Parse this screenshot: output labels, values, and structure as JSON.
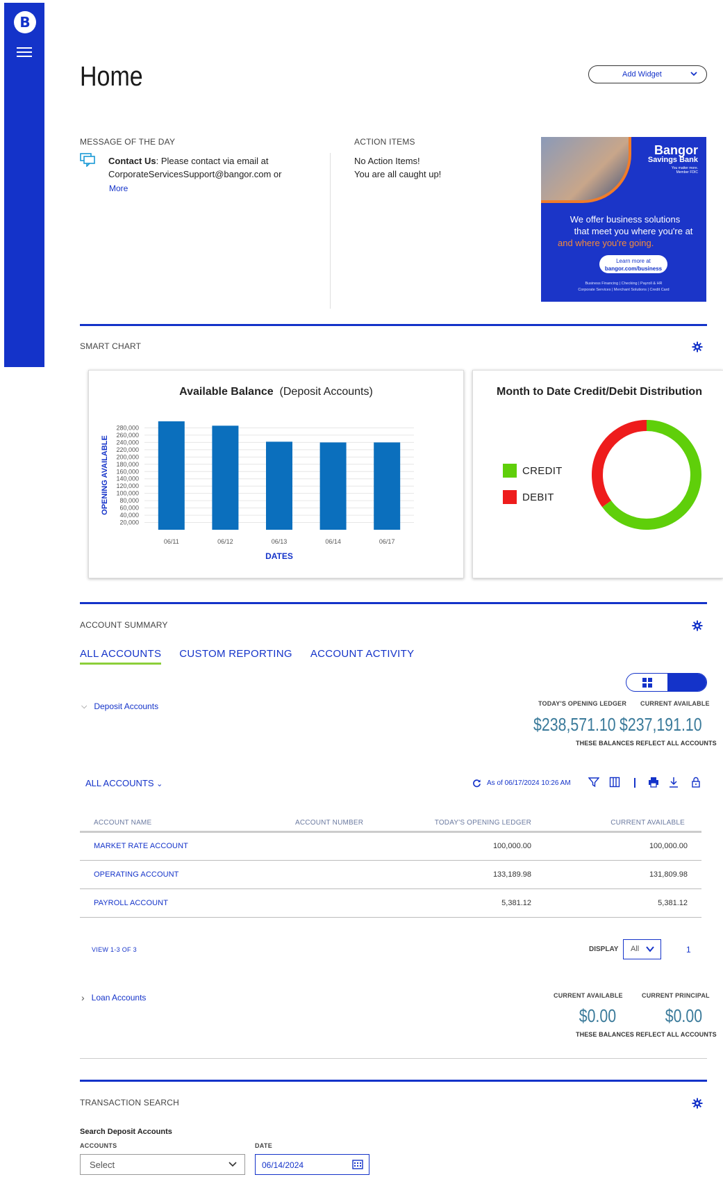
{
  "brand": {
    "logo_letter": "B",
    "accent": "#1433c9"
  },
  "page": {
    "title": "Home",
    "add_widget_label": "Add Widget"
  },
  "message_of_day": {
    "section_label": "MESSAGE OF THE DAY",
    "icon": "chat-icon",
    "bold_prefix": "Contact Us",
    "text": ": Please contact via email at CorporateServicesSupport@bangor.com or",
    "more_label": "More"
  },
  "action_items": {
    "section_label": "ACTION ITEMS",
    "line1": "No Action Items!",
    "line2": "You are all caught up!"
  },
  "promo": {
    "bank_name_1": "Bangor",
    "bank_name_2": "Savings Bank",
    "tagline": "You matter more.",
    "member": "Member FDIC",
    "headline_1": "We offer business solutions",
    "headline_2": "that meet you where you're at",
    "headline_3": "and where you're going.",
    "cta_1": "Learn more at",
    "cta_2": "bangor.com/business",
    "fine_1": "Business Financing | Checking | Payroll & HR",
    "fine_2": "Corporate Services | Merchant Solutions | Credit Card"
  },
  "smart_chart": {
    "section_label": "SMART CHART"
  },
  "chart_data": [
    {
      "type": "bar",
      "title_bold": "Available Balance",
      "title_rest": "(Deposit Accounts)",
      "xlabel": "DATES",
      "ylabel": "OPENING AVAILABLE",
      "categories": [
        "06/11",
        "06/12",
        "06/13",
        "06/14",
        "06/17"
      ],
      "values": [
        298000,
        286000,
        242000,
        240000,
        240000
      ],
      "yticks": [
        "280,000",
        "260,000",
        "240,000",
        "220,000",
        "200,000",
        "180,000",
        "160,000",
        "140,000",
        "120,000",
        "100,000",
        "80,000",
        "60,000",
        "40,000",
        "20,000"
      ],
      "ylim": [
        0,
        300000
      ],
      "bar_color": "#0b6fbd",
      "grid": true
    },
    {
      "type": "pie",
      "title": "Month to Date Credit/Debit Distribution",
      "labels": [
        "CREDIT",
        "DEBIT"
      ],
      "values": [
        65,
        35
      ],
      "colors": [
        "#5fcf0a",
        "#ee1c1c"
      ]
    }
  ],
  "account_summary": {
    "section_label": "ACCOUNT SUMMARY",
    "tabs": [
      {
        "label": "ALL ACCOUNTS",
        "active": true
      },
      {
        "label": "CUSTOM REPORTING",
        "active": false
      },
      {
        "label": "ACCOUNT ACTIVITY",
        "active": false
      }
    ],
    "deposit": {
      "group_label": "Deposit Accounts",
      "opening_label": "TODAY'S OPENING LEDGER",
      "available_label": "CURRENT AVAILABLE",
      "opening_value": "$238,571.10",
      "available_value": "$237,191.10",
      "note": "THESE BALANCES REFLECT ALL ACCOUNTS"
    },
    "filter_label": "ALL ACCOUNTS",
    "as_of": "As of 06/17/2024 10:26 AM",
    "table": {
      "headers": [
        "ACCOUNT NAME",
        "ACCOUNT NUMBER",
        "TODAY'S OPENING LEDGER",
        "CURRENT AVAILABLE"
      ],
      "rows": [
        {
          "name": "MARKET RATE ACCOUNT",
          "number": "",
          "opening": "100,000.00",
          "available": "100,000.00"
        },
        {
          "name": "OPERATING ACCOUNT",
          "number": "",
          "opening": "133,189.98",
          "available": "131,809.98"
        },
        {
          "name": "PAYROLL ACCOUNT",
          "number": "",
          "opening": "5,381.12",
          "available": "5,381.12"
        }
      ]
    },
    "view_count": "VIEW 1-3 OF 3",
    "display_label": "DISPLAY",
    "display_value": "All",
    "page_number": "1",
    "loan": {
      "group_label": "Loan Accounts",
      "available_label": "CURRENT AVAILABLE",
      "principal_label": "CURRENT PRINCIPAL",
      "available_value": "$0.00",
      "principal_value": "$0.00",
      "note": "THESE BALANCES REFLECT ALL ACCOUNTS"
    }
  },
  "transaction_search": {
    "section_label": "TRANSACTION SEARCH",
    "heading": "Search Deposit Accounts",
    "accounts_label": "ACCOUNTS",
    "accounts_value": "Select",
    "date_label": "DATE",
    "date_value": "06/14/2024"
  }
}
